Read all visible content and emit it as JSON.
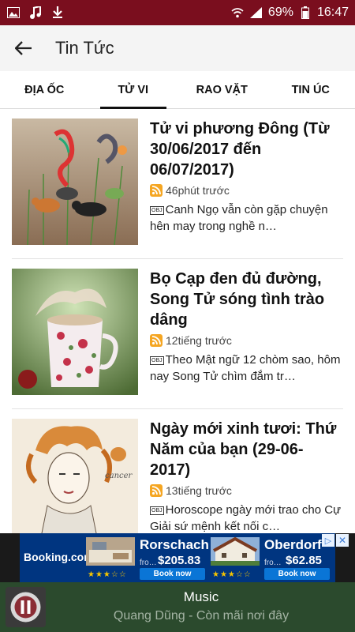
{
  "status_bar": {
    "battery": "69%",
    "time": "16:47"
  },
  "toolbar": {
    "title": "Tin Tức"
  },
  "tabs": [
    {
      "label": "ĐỊA ỐC",
      "active": false
    },
    {
      "label": "TỬ VI",
      "active": true
    },
    {
      "label": "RAO VẶT",
      "active": false
    },
    {
      "label": "TIN ÚC",
      "active": false
    }
  ],
  "articles": [
    {
      "title": "Tử vi phương Đông (Từ 30/06/2017 đến 06/07/2017)",
      "time": "46phút trước",
      "summary_tag": "OBJ",
      "summary": "Canh Ngọ vẫn còn gặp chuyện hên may trong nghề n…"
    },
    {
      "title": "Bọ Cạp đen đủ đường, Song Tử sóng tình trào dâng",
      "time": "12tiếng trước",
      "summary_tag": "OBJ",
      "summary": "Theo Mật ngữ 12 chòm sao, hôm nay Song Tử chìm đắm tr…"
    },
    {
      "title": "Ngày mới xinh tươi: Thứ Năm của bạn (29-06-2017)",
      "time": "13tiếng trước",
      "summary_tag": "OBJ",
      "summary": "Horoscope ngày mới trao cho Cự Giải sứ mệnh kết nối c…"
    }
  ],
  "ad": {
    "brand": "Booking.com",
    "hotels": [
      {
        "name": "Rorschach",
        "from": "fro…",
        "price": "$205.83",
        "button": "Book now",
        "stars": "★★★☆☆"
      },
      {
        "name": "Oberdorf",
        "from": "fro…",
        "price": "$62.85",
        "button": "Book now",
        "stars": "★★★☆☆"
      }
    ],
    "choices_icon": "▷",
    "close_icon": "✕"
  },
  "player": {
    "title": "Music",
    "subtitle": "Quang Dũng - Còn mãi nơi đây"
  },
  "colors": {
    "status_bar": "#7a0e1e",
    "player_bg": "#2b4a2d",
    "ad_bg": "#003580",
    "rss": "#f5a623"
  }
}
